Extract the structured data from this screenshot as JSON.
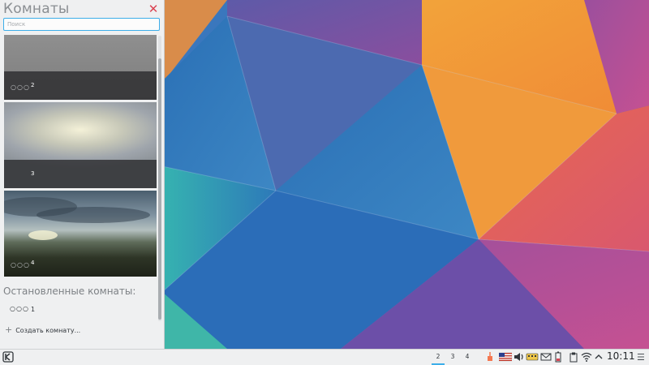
{
  "panel": {
    "title": "Комнаты",
    "search_placeholder": "Поиск",
    "activities": [
      {
        "label": "2",
        "dots": "○○○"
      },
      {
        "label": "3",
        "dots": ""
      },
      {
        "label": "4",
        "dots": "○○○"
      }
    ],
    "stopped_heading": "Остановленные комнаты:",
    "stopped": [
      {
        "label": "1",
        "dots": "○○○"
      }
    ],
    "create_label": "Создать комнату..."
  },
  "taskbar": {
    "pager": [
      "2",
      "3",
      "4"
    ],
    "active_page": "2",
    "clock": "10:11"
  },
  "colors": {
    "accent": "#3daee9",
    "close": "#da4453",
    "panel_bg": "#eff0f1"
  },
  "icons": {
    "launcher": "kde-logo-icon",
    "close": "close-icon",
    "tray": [
      "updates-icon",
      "us-flag-icon",
      "volume-icon",
      "keyboard-layout-icon",
      "mail-icon",
      "battery-icon",
      "wifi-icon",
      "clipboard-icon",
      "expand-up-icon"
    ],
    "menu": "hamburger-menu-icon"
  }
}
